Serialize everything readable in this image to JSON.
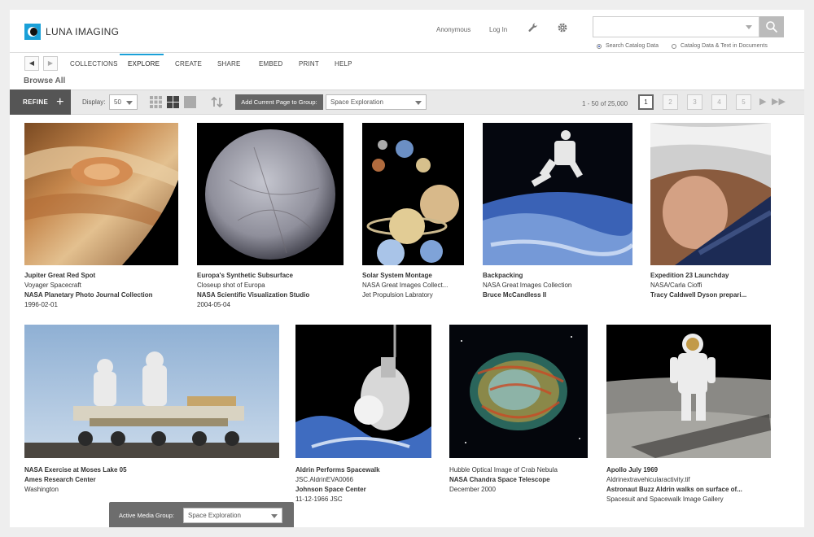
{
  "app": {
    "logo_text": "LUNA IMAGING"
  },
  "header": {
    "links": {
      "anonymous": "Anonymous",
      "login": "Log In"
    },
    "search": {
      "placeholder": ""
    },
    "search_options": [
      {
        "label": "Search Catalog Data",
        "selected": true
      },
      {
        "label": "Catalog Data & Text in Documents",
        "selected": false
      }
    ]
  },
  "nav": {
    "items": [
      "COLLECTIONS",
      "EXPLORE",
      "CREATE",
      "SHARE",
      "EMBED",
      "PRINT",
      "HELP"
    ],
    "active": "EXPLORE"
  },
  "page_title": "Browse All",
  "toolbar": {
    "refine": "REFINE",
    "display_label": "Display:",
    "display_value": "50",
    "add_group_label": "Add Current Page to Group:",
    "group_value": "Space Exploration",
    "range": "1 - 50 of 25,000",
    "pages": [
      "1",
      "2",
      "3",
      "4",
      "5"
    ],
    "current_page": "1"
  },
  "items": [
    {
      "title": "Jupiter Great Red Spot",
      "lines": [
        {
          "text": "Voyager Spacecraft",
          "bold": false
        },
        {
          "text": "NASA Planetary Photo Journal Collection",
          "bold": true
        },
        {
          "text": "1996-02-01",
          "bold": false
        }
      ]
    },
    {
      "title": "Europa's Synthetic Subsurface",
      "lines": [
        {
          "text": "Closeup shot of Europa",
          "bold": false
        },
        {
          "text": "NASA Scientific Visualization Studio",
          "bold": true
        },
        {
          "text": "2004-05-04",
          "bold": false
        }
      ]
    },
    {
      "title": "Solar System Montage",
      "lines": [
        {
          "text": "NASA Great Images Collect...",
          "bold": false
        },
        {
          "text": "Jet Propulsion Labratory",
          "bold": false
        }
      ]
    },
    {
      "title": "Backpacking",
      "lines": [
        {
          "text": "NASA Great Images Collection",
          "bold": false
        },
        {
          "text": "Bruce McCandless II",
          "bold": true
        }
      ]
    },
    {
      "title": "Expedition 23 Launchday",
      "lines": [
        {
          "text": "NASA/Carla Cioffi",
          "bold": false
        },
        {
          "text": "Tracy Caldwell Dyson prepari...",
          "bold": true
        }
      ]
    },
    {
      "title": "NASA Exercise at Moses Lake 05",
      "lines": [
        {
          "text": "Ames Research Center",
          "bold": true
        },
        {
          "text": "Washington",
          "bold": false
        }
      ]
    },
    {
      "title": "Aldrin Performs Spacewalk",
      "lines": [
        {
          "text": "JSC.AldrinEVA0066",
          "bold": false
        },
        {
          "text": "Johnson Space Center",
          "bold": true
        },
        {
          "text": "11-12-1966 JSC",
          "bold": false
        }
      ]
    },
    {
      "title": "",
      "lines": [
        {
          "text": "Hubble Optical Image of Crab Nebula",
          "bold": false
        },
        {
          "text": "NASA Chandra Space Telescope",
          "bold": true
        },
        {
          "text": "December 2000",
          "bold": false
        }
      ]
    },
    {
      "title": "Apollo July 1969",
      "lines": [
        {
          "text": "Aldrinextravehicularactivity.tif",
          "bold": false
        },
        {
          "text": "Astronaut Buzz Aldrin walks on surface of...",
          "bold": true
        },
        {
          "text": "Spacesuit and Spacewalk Image Gallery",
          "bold": false
        }
      ]
    }
  ],
  "media_group": {
    "label": "Active Media Group:",
    "value": "Space Exploration"
  },
  "colors": {
    "accent": "#1aa0d8",
    "refine_bg": "#555555",
    "toolbar_bg": "#e9e9e9"
  },
  "icons": [
    "wrench-icon",
    "gear-icon",
    "search-icon",
    "back-arrow-icon",
    "forward-arrow-icon",
    "grid-small-icon",
    "grid-large-icon",
    "single-view-icon",
    "sort-icon",
    "next-page-icon",
    "last-page-icon"
  ]
}
